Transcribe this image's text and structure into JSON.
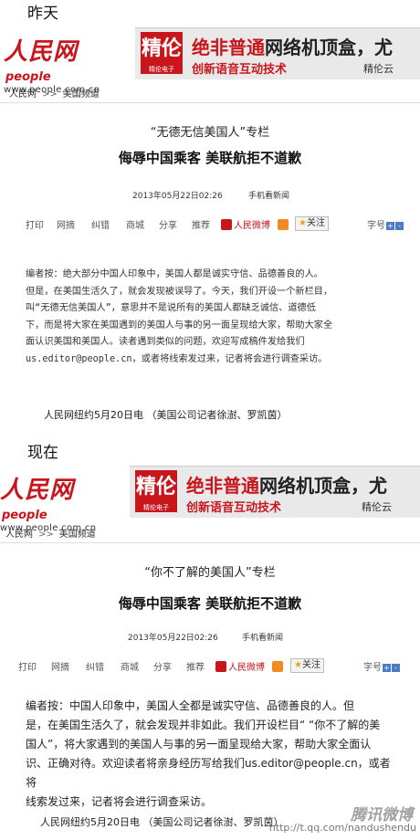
{
  "labels": {
    "before": "昨天",
    "after": "现在"
  },
  "site": {
    "logo_cn": "人民网",
    "logo_en": "people",
    "logo_url": "www.people.com.cn"
  },
  "ad": {
    "badge": "精伦",
    "badge_sub": "精伦电子",
    "title_red": "绝非普通",
    "title_dark": "网络机顶盒，尤",
    "subtitle": "创新语音互动技术",
    "brand_top": "精伦云",
    "brand_bottom": "精伦云"
  },
  "breadcrumb": {
    "home": "人民网",
    "sep": ">>",
    "channel": "美国频道"
  },
  "toolbar": {
    "items": [
      "打印",
      "网摘",
      "纠错",
      "商城",
      "分享",
      "推荐"
    ],
    "weibo": "人民微博",
    "follow": "关注",
    "fontsize_label": "字号",
    "plus": "+",
    "minus": "-"
  },
  "before": {
    "column": "“无德无信美国人”专栏",
    "headline": "侮辱中国乘客 美联航拒不道歉",
    "date": "2013年05月22日02:26",
    "mobile": "手机看新闻",
    "body": "编者按：绝大部分中国人印象中，美国人都是诚实守信、品德善良的人。\n但是，在美国生活久了，就会发现被误导了。今天，我们开设一个新栏目，\n叫“无德无信美国人”，意思并不是说所有的美国人都缺乏诚信、道德低\n下，而是将大家在美国遇到的美国人与事的另一面呈现给大家，帮助大家全\n面认识美国和美国人。读者遇到类似的问题，欢迎写成稿件发给我们\nus.editor@people.cn，或者将线索发过来，记者将会进行调查采访。",
    "dateline": "人民网纽约5月20日电 （美国公司记者徐澍、罗凯茵）"
  },
  "after": {
    "column": "“你不了解的美国人”专栏",
    "headline": "侮辱中国乘客 美联航拒不道歉",
    "date": "2013年05月22日02:26",
    "mobile": "手机看新闻",
    "body": "编者按：中国人印象中，美国人全都是诚实守信、品德善良的人。但\n是，在美国生活久了，就会发现并非如此。我们开设栏目“ “你不了解的美\n国人”，将大家遇到的美国人与事的另一面呈现给大家，帮助大家全面认\n识、正确对待。欢迎读者将亲身经历写给我们us.editor@people.cn，或者将\n线索发过来，记者将会进行调查采访。",
    "dateline": "人民网纽约5月20日电 （美国公司记者徐澍、罗凯茵）"
  },
  "watermark": {
    "brand": "腾讯微博",
    "url": "http://t.qq.com/nandushendu"
  }
}
